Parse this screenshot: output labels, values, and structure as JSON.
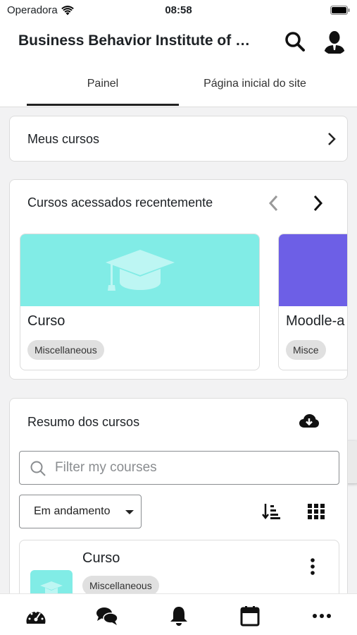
{
  "status": {
    "carrier": "Operadora",
    "time": "08:58"
  },
  "header": {
    "title": "Business Behavior Institute of C..."
  },
  "tabs": [
    {
      "label": "Painel",
      "active": true
    },
    {
      "label": "Página inicial do site",
      "active": false
    }
  ],
  "my_courses": {
    "label": "Meus cursos"
  },
  "recent": {
    "heading": "Cursos acessados recentemente",
    "courses": [
      {
        "name": "Curso",
        "category": "Miscellaneous",
        "color": "#81ece6"
      },
      {
        "name": "Moodle-a",
        "category": "Misce",
        "color": "#6d5fe6"
      }
    ]
  },
  "overview": {
    "heading": "Resumo dos cursos",
    "filter_placeholder": "Filter my courses",
    "status_select": "Em andamento",
    "items": [
      {
        "name": "Curso",
        "category": "Miscellaneous"
      }
    ]
  },
  "colors": {
    "accent": "#1d2125",
    "banner_teal": "#81ece6",
    "banner_purple": "#6d5fe6"
  }
}
